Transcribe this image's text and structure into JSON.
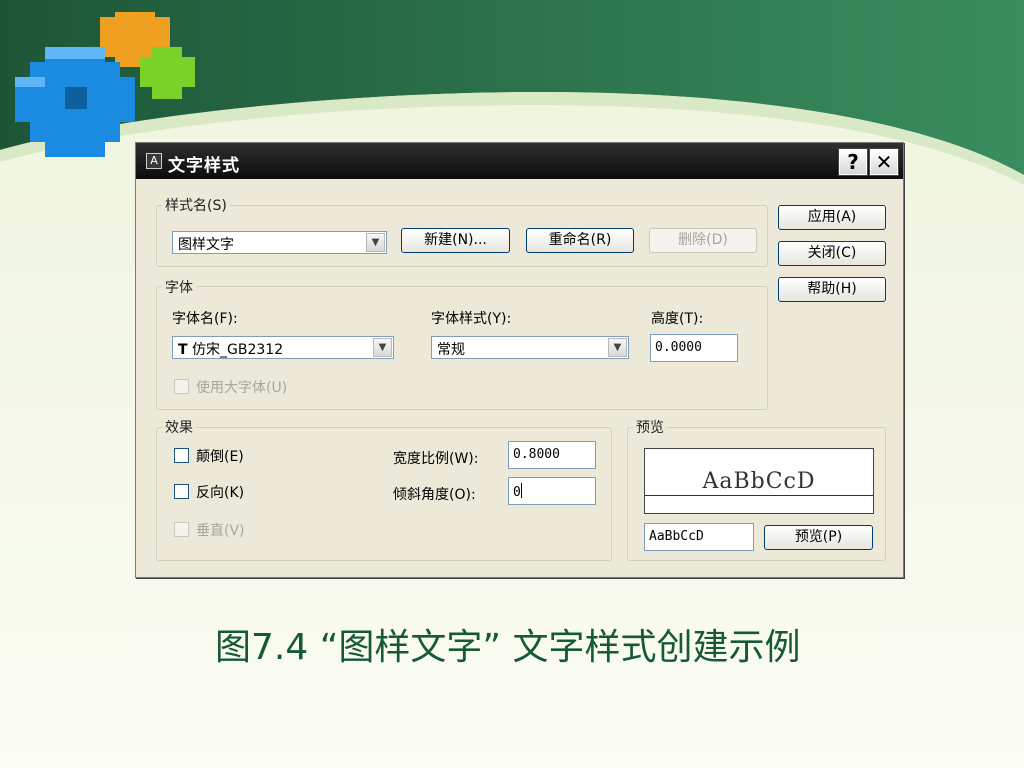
{
  "dialog": {
    "title": "文字样式",
    "help_glyph": "?",
    "close_glyph": "✕",
    "style_group_label": "样式名(S)",
    "style_name_value": "图样文字",
    "new_button": "新建(N)...",
    "rename_button": "重命名(R)",
    "delete_button": "删除(D)",
    "apply_button": "应用(A)",
    "close_button": "关闭(C)",
    "help_button": "帮助(H)",
    "font_group_label": "字体",
    "font_name_label": "字体名(F):",
    "font_name_value": "仿宋_GB2312",
    "font_style_label": "字体样式(Y):",
    "font_style_value": "常规",
    "height_label": "高度(T):",
    "height_value": "0.0000",
    "big_font_label": "使用大字体(U)",
    "effects_group_label": "效果",
    "upside_down_label": "颠倒(E)",
    "backwards_label": "反向(K)",
    "vertical_label": "垂直(V)",
    "width_factor_label": "宽度比例(W):",
    "width_factor_value": "0.8000",
    "oblique_angle_label": "倾斜角度(O):",
    "oblique_angle_value": "0",
    "preview_group_label": "预览",
    "preview_sample": "AaBbCcD",
    "preview_input_value": "AaBbCcD",
    "preview_button": "预览(P)"
  },
  "caption": "图7.4 “图样文字” 文字样式创建示例",
  "colors": {
    "slide_green_dark": "#1e5a3a",
    "slide_green": "#2f7d52",
    "caption": "#155a33",
    "dialog_face": "#ece9d8"
  },
  "icons": [
    "font-truetype-icon",
    "dropdown-arrow-icon",
    "logo-cubes"
  ]
}
